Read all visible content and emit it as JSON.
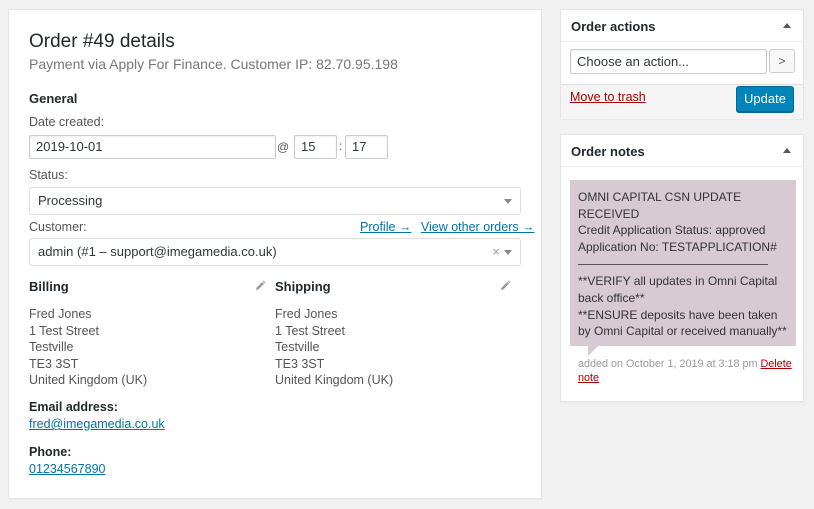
{
  "order": {
    "title": "Order #49 details",
    "subtitle": "Payment via Apply For Finance. Customer IP: 82.70.95.198",
    "general": {
      "heading": "General",
      "date_label": "Date created:",
      "date_value": "2019-10-01",
      "at_sign": "@",
      "hour": "15",
      "colon": ":",
      "minute": "17",
      "status_label": "Status:",
      "status_value": "Processing",
      "customer_label": "Customer:",
      "profile_link": "Profile →",
      "other_orders_link": "View other orders →",
      "customer_value": "admin (#1 – support@imegamedia.co.uk)",
      "clear_symbol": "×"
    },
    "billing": {
      "heading": "Billing",
      "lines": [
        "Fred Jones",
        "1 Test Street",
        "Testville",
        "TE3 3ST",
        "United Kingdom (UK)"
      ],
      "email_label": "Email address:",
      "email": "fred@imegamedia.co.uk",
      "phone_label": "Phone:",
      "phone": "01234567890"
    },
    "shipping": {
      "heading": "Shipping",
      "lines": [
        "Fred Jones",
        "1 Test Street",
        "Testville",
        "TE3 3ST",
        "United Kingdom (UK)"
      ]
    }
  },
  "actions": {
    "heading": "Order actions",
    "select_value": "Choose an action...",
    "go_symbol": ">",
    "trash_label": "Move to trash",
    "update_label": "Update"
  },
  "notes": {
    "heading": "Order notes",
    "note": {
      "lines_top": [
        "OMNI CAPITAL CSN UPDATE",
        "RECEIVED",
        "Credit Application Status: approved",
        "Application No: TESTAPPLICATION#"
      ],
      "lines_bottom": [
        "**VERIFY all updates in Omni Capital",
        "back office**",
        "**ENSURE deposits have been taken",
        "by Omni Capital or received manually**"
      ],
      "meta": "added on October 1, 2019 at 3:18 pm",
      "delete_label": "Delete note"
    }
  },
  "colors": {
    "primary": "#0085ba",
    "link": "#0073aa",
    "danger": "#a00",
    "note_bg": "#d7cad2"
  },
  "icons": [
    "edit-pencil-icon",
    "dropdown-caret-icon",
    "toggle-triangle-icon",
    "chevron-right-icon"
  ]
}
